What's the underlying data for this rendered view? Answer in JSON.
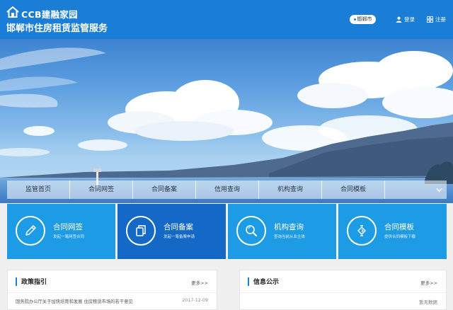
{
  "header": {
    "brand": "CCB建融家园",
    "subtitle": "邯郸市住房租赁监管服务",
    "city": "邯郸市",
    "login": "登录",
    "register": "注册"
  },
  "nav": {
    "items": [
      "监管首页",
      "合同网签",
      "合同备案",
      "信用查询",
      "机构查询",
      "合同模板"
    ]
  },
  "tiles": [
    {
      "title": "合同网签",
      "subtitle": "发起一笔网签合同",
      "icon": "pen-icon"
    },
    {
      "title": "合同备案",
      "subtitle": "发起一笔备案申请",
      "icon": "copy-document-icon"
    },
    {
      "title": "机构查询",
      "subtitle": "查询当前从业主体",
      "icon": "magnifier-icon"
    },
    {
      "title": "合同模板",
      "subtitle": "提供合同模板下载",
      "icon": "template-icon"
    }
  ],
  "policy": {
    "title": "政策指引",
    "more": "更多>>",
    "news": [
      {
        "text": "国务院办公厅关于加快培育和发展 住房租赁市场的若干意见",
        "date": "2017-12-09"
      }
    ]
  },
  "info": {
    "title": "信息公示",
    "more": "更多>>",
    "empty": "暂无数据"
  },
  "colors": {
    "header_blue": "#1a7dd6",
    "tile_blue": "#1e9be5",
    "tile_active": "#1469c7"
  }
}
